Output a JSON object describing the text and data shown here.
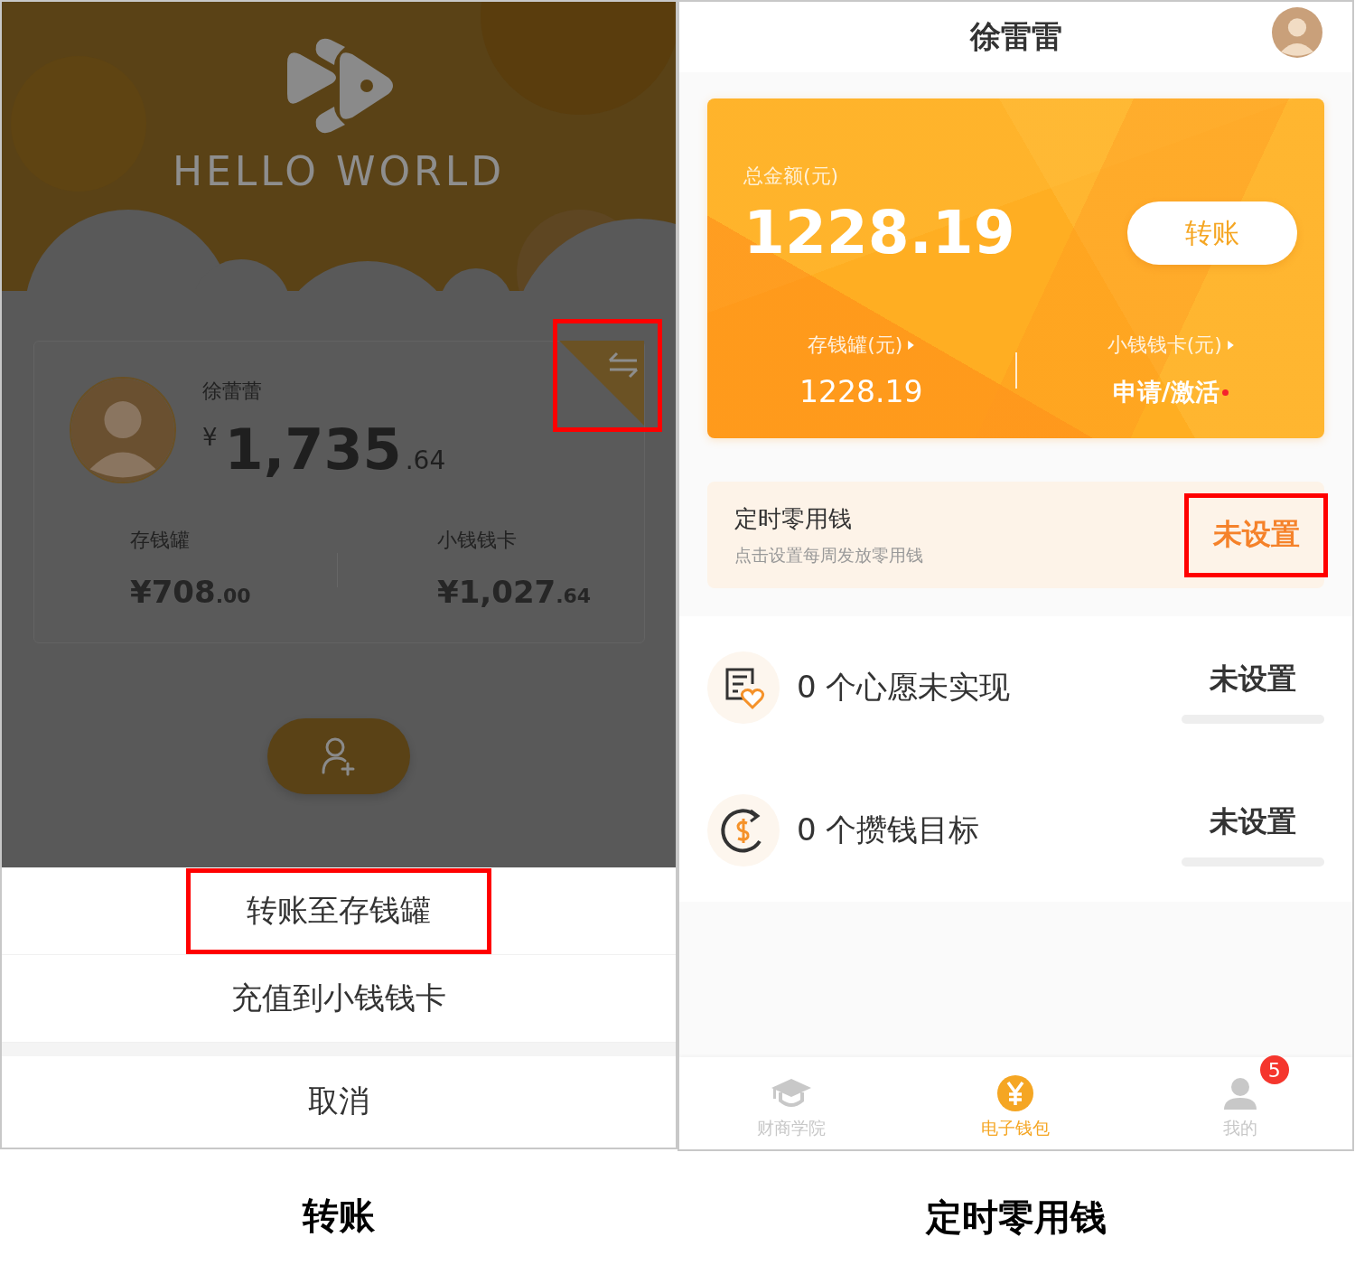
{
  "transfer_screen": {
    "banner": {
      "logo_text": "HELLO WORLD"
    },
    "child_card": {
      "name": "徐蕾蕾",
      "currency": "¥",
      "balance_integer": "1,735",
      "balance_decimal": ".64",
      "switch_highlighted": true,
      "accounts": [
        {
          "label": "存钱罐",
          "amount": "¥708",
          "decimals": ".00"
        },
        {
          "label": "小钱钱卡",
          "amount": "¥1,027",
          "decimals": ".64"
        }
      ]
    },
    "action_sheet": {
      "items": [
        {
          "label": "转账至存钱罐",
          "highlighted": true
        },
        {
          "label": "充值到小钱钱卡",
          "highlighted": false
        }
      ],
      "cancel": "取消"
    },
    "caption": "转账"
  },
  "wallet_screen": {
    "title": "徐雷雷",
    "balance_card": {
      "total_label": "总金额(元)",
      "total": "1228.19",
      "transfer_button": "转账",
      "accounts": [
        {
          "label": "存钱罐(元)",
          "value": "1228.19",
          "kind": "amount",
          "dot": false
        },
        {
          "label": "小钱钱卡(元)",
          "value": "申请/激活",
          "kind": "action",
          "dot": true
        }
      ]
    },
    "allowance": {
      "title": "定时零用钱",
      "subtitle": "点击设置每周发放零用钱",
      "status": "未设置",
      "highlighted": true
    },
    "goals": [
      {
        "text": "0 个心愿未实现",
        "status": "未设置",
        "level": 0
      },
      {
        "text": "0 个攒钱目标",
        "status": "未设置",
        "level": 0
      }
    ],
    "tab_bar": [
      {
        "label": "财商学院",
        "selected": false
      },
      {
        "label": "电子钱包",
        "selected": true
      },
      {
        "label": "我的",
        "selected": false,
        "badge": "5"
      }
    ],
    "caption": "定时零用钱"
  }
}
